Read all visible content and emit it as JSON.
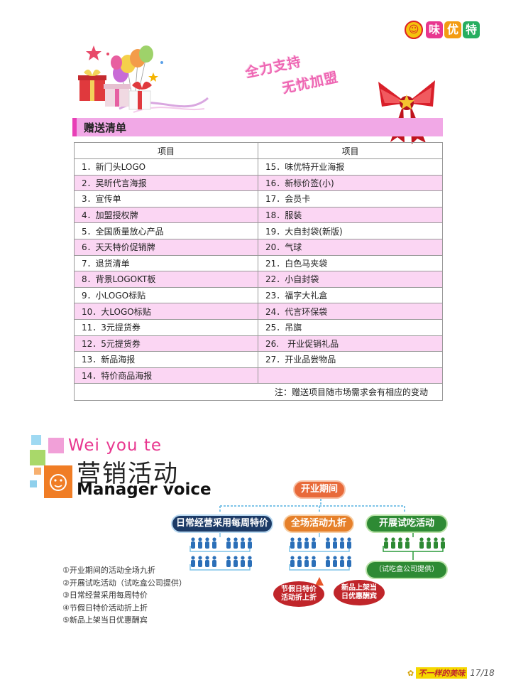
{
  "logo": {
    "chars": [
      "味",
      "优",
      "特"
    ],
    "colors": [
      "#e8368f",
      "#f39c12",
      "#27ae60"
    ]
  },
  "slogan": {
    "line1": "全力支持",
    "line2": "无忧加盟"
  },
  "section_title": "赠送清单",
  "table": {
    "headers": [
      "项目",
      "项目"
    ],
    "rows": [
      [
        "1．新门头LOGO",
        "15．味优特开业海报"
      ],
      [
        "2．吴昕代言海报",
        "16．新标价签(小)"
      ],
      [
        "3．宣传单",
        "17．会员卡"
      ],
      [
        "4．加盟授权牌",
        "18．服装"
      ],
      [
        "5．全国质量放心产品",
        "19．大自封袋(新版)"
      ],
      [
        "6．天天特价促销牌",
        "20．气球"
      ],
      [
        "7．退货清单",
        "21．白色马夹袋"
      ],
      [
        "8．背景LOGOKT板",
        "22．小自封袋"
      ],
      [
        "9．小LOGO标贴",
        "23．福字大礼盒"
      ],
      [
        "10．大LOGO标贴",
        "24．代言环保袋"
      ],
      [
        "11．3元提货券",
        "25．吊旗"
      ],
      [
        "12．5元提货券",
        "26.　开业促销礼品"
      ],
      [
        "13．新品海报",
        "27．开业品尝物品"
      ],
      [
        "14．特价商品海报",
        ""
      ]
    ],
    "note": "注：赠送项目随市场需求会有相应的变动"
  },
  "marketing": {
    "brand_en": "Wei you te",
    "title_cn": "营销活动",
    "title_en": "Manager voice",
    "diagram": {
      "root": "开业期间",
      "branch_left": "日常经营采用每周特价",
      "branch_mid": "全场活动九折",
      "branch_right": "开展试吃活动",
      "right_sub": "（试吃盒公司提供）",
      "mid_sub1": "节假日特价活动折上折",
      "mid_sub2": "新品上架当日优惠酬宾"
    },
    "list": [
      "①开业期间的活动全场九折",
      "②开展试吃活动（试吃盒公司提供）",
      "③日常经营采用每周特价",
      "④节假日特价活动折上折",
      "⑤新品上架当日优惠酬宾"
    ]
  },
  "footer": {
    "tagline": "不一样的美味",
    "page": "17/18"
  }
}
